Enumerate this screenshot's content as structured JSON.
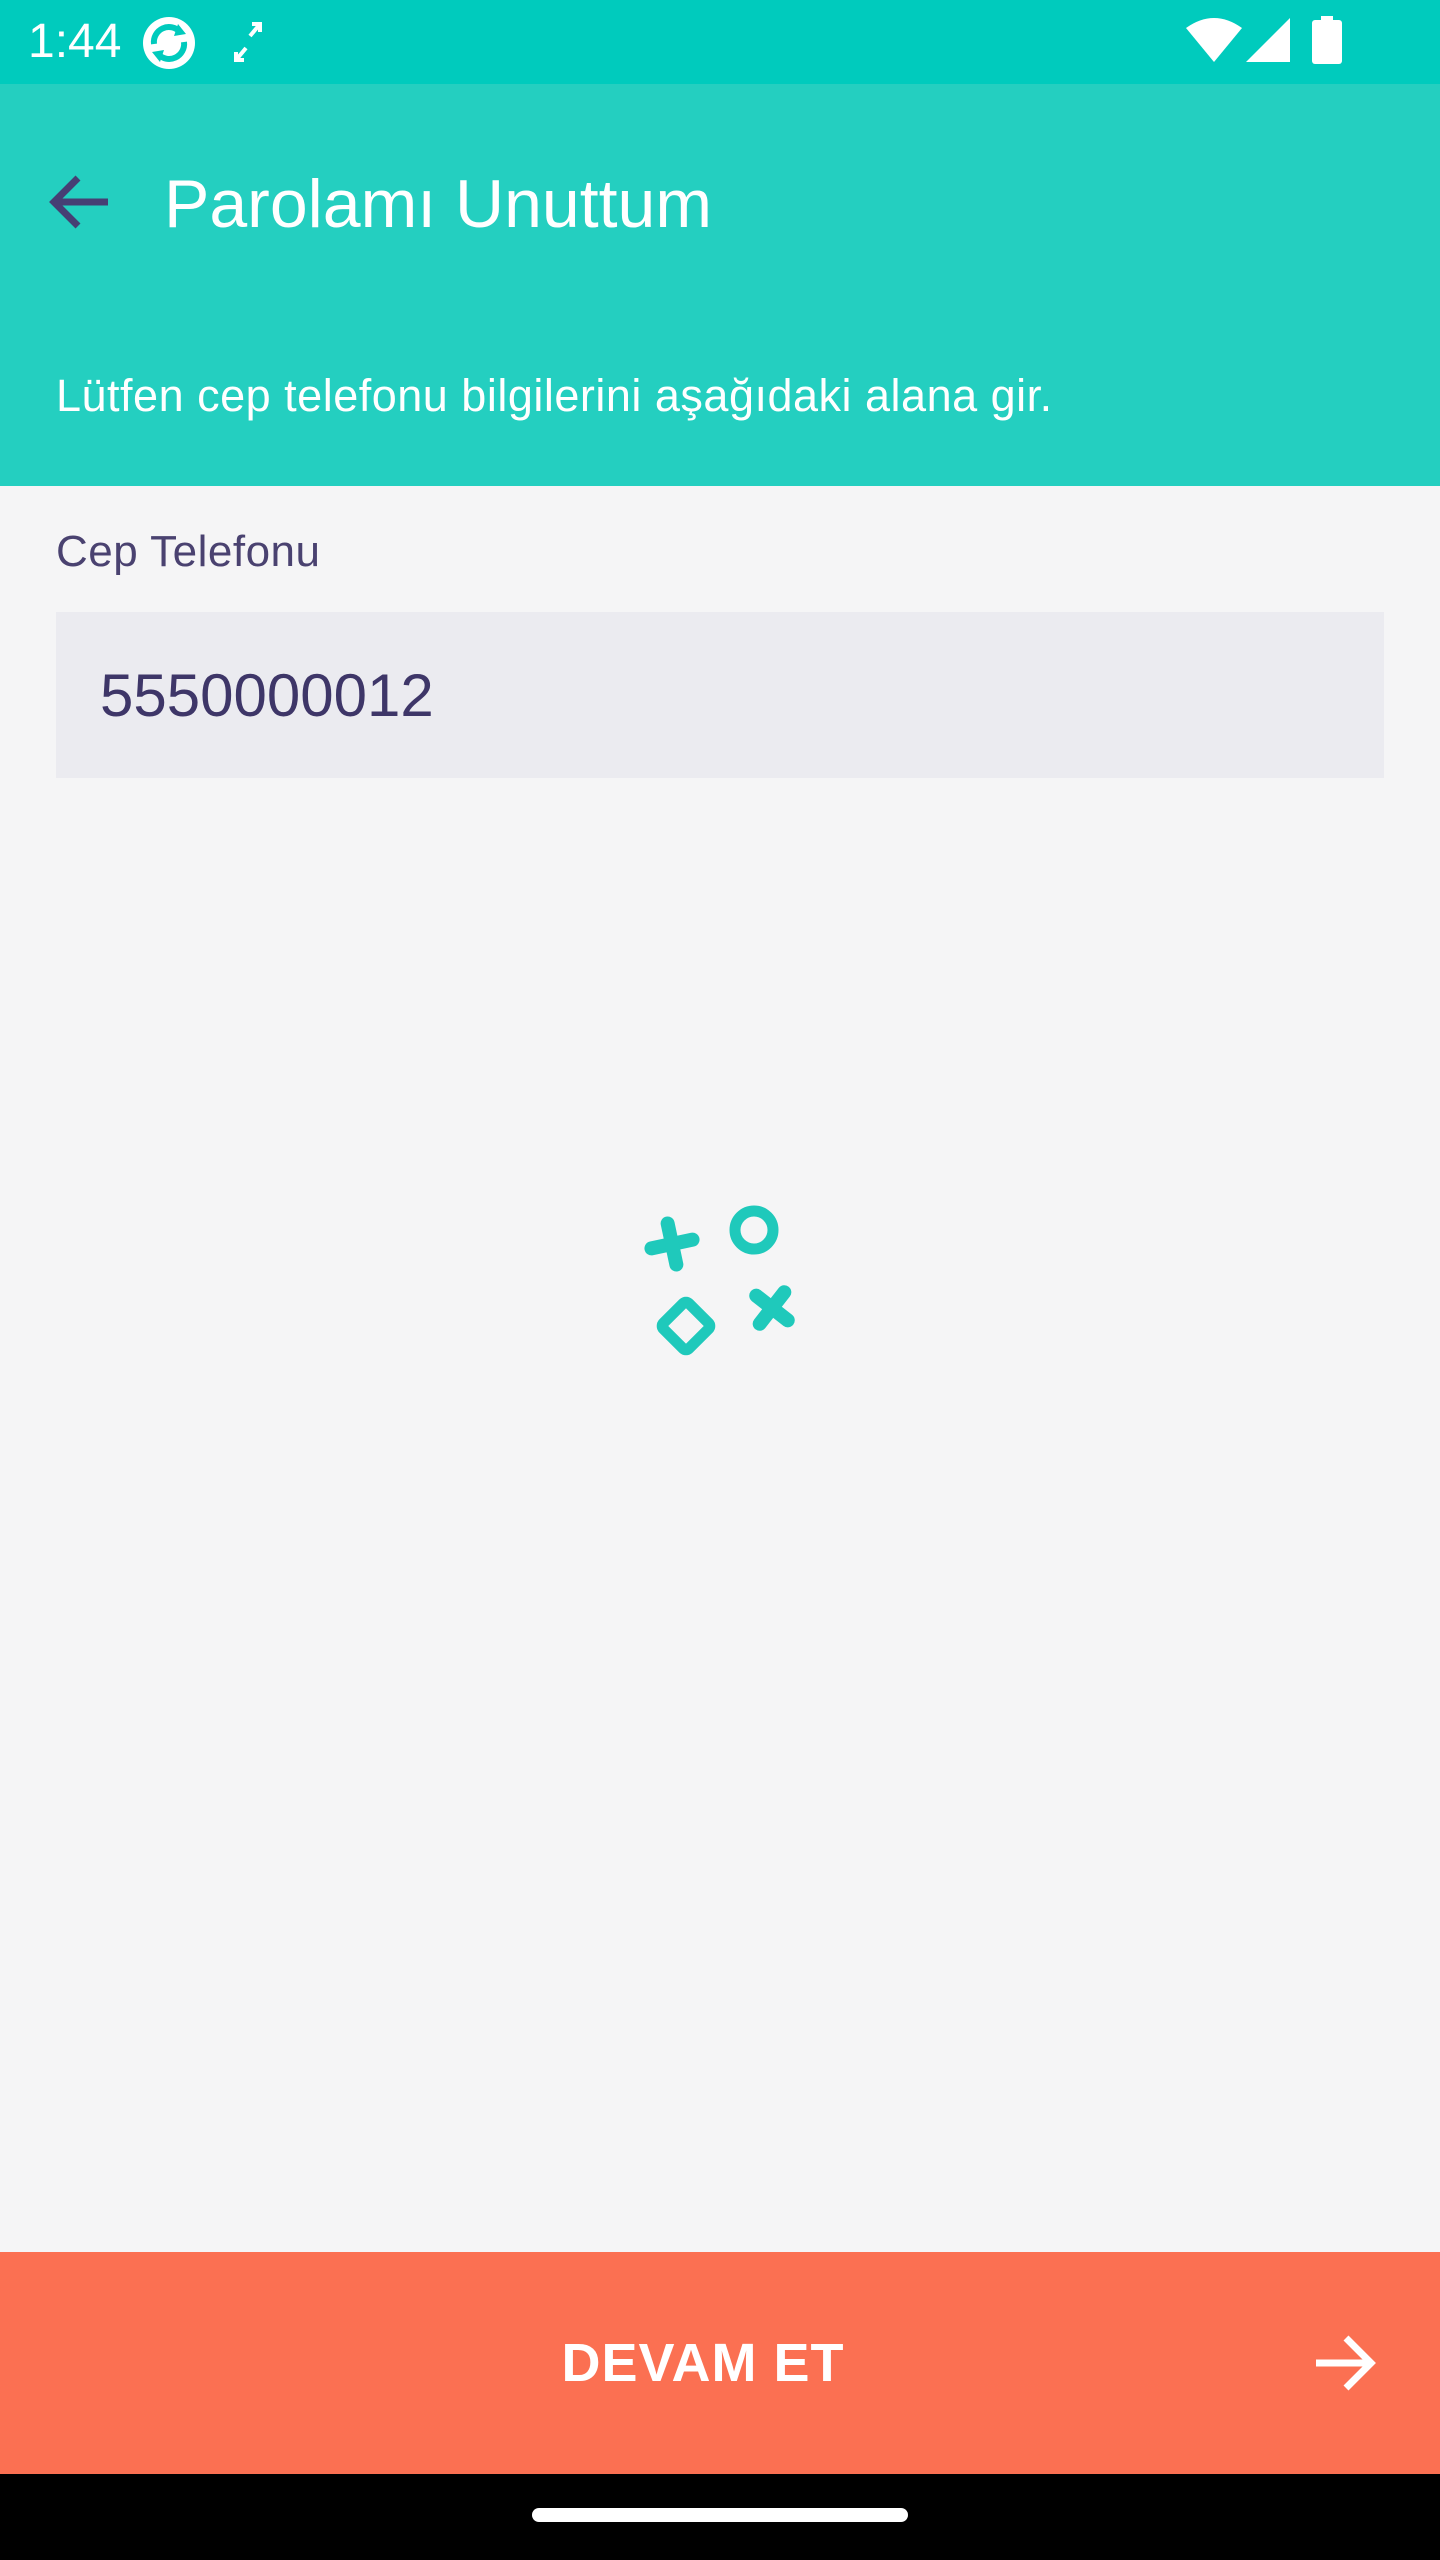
{
  "status_bar": {
    "time": "1:44",
    "background": "#00cbbd",
    "icons": [
      "sync-app-icon",
      "fullscreen-arrows-icon",
      "wifi-icon",
      "cellular-signal-icon",
      "battery-icon"
    ]
  },
  "app_bar": {
    "title": "Parolamı Unuttum",
    "instruction": "Lütfen cep telefonu bilgilerini aşağıdaki alana gir.",
    "background": "#24cfc0",
    "back_icon": "arrow-left-icon"
  },
  "form": {
    "phone_label": "Cep Telefonu",
    "phone_value": "5550000012"
  },
  "loader": {
    "icon": "loading-shapes-icon",
    "color": "#1fc9bb"
  },
  "footer": {
    "continue_label": "DEVAM ET",
    "continue_icon": "arrow-right-icon",
    "background": "#fb7052"
  }
}
